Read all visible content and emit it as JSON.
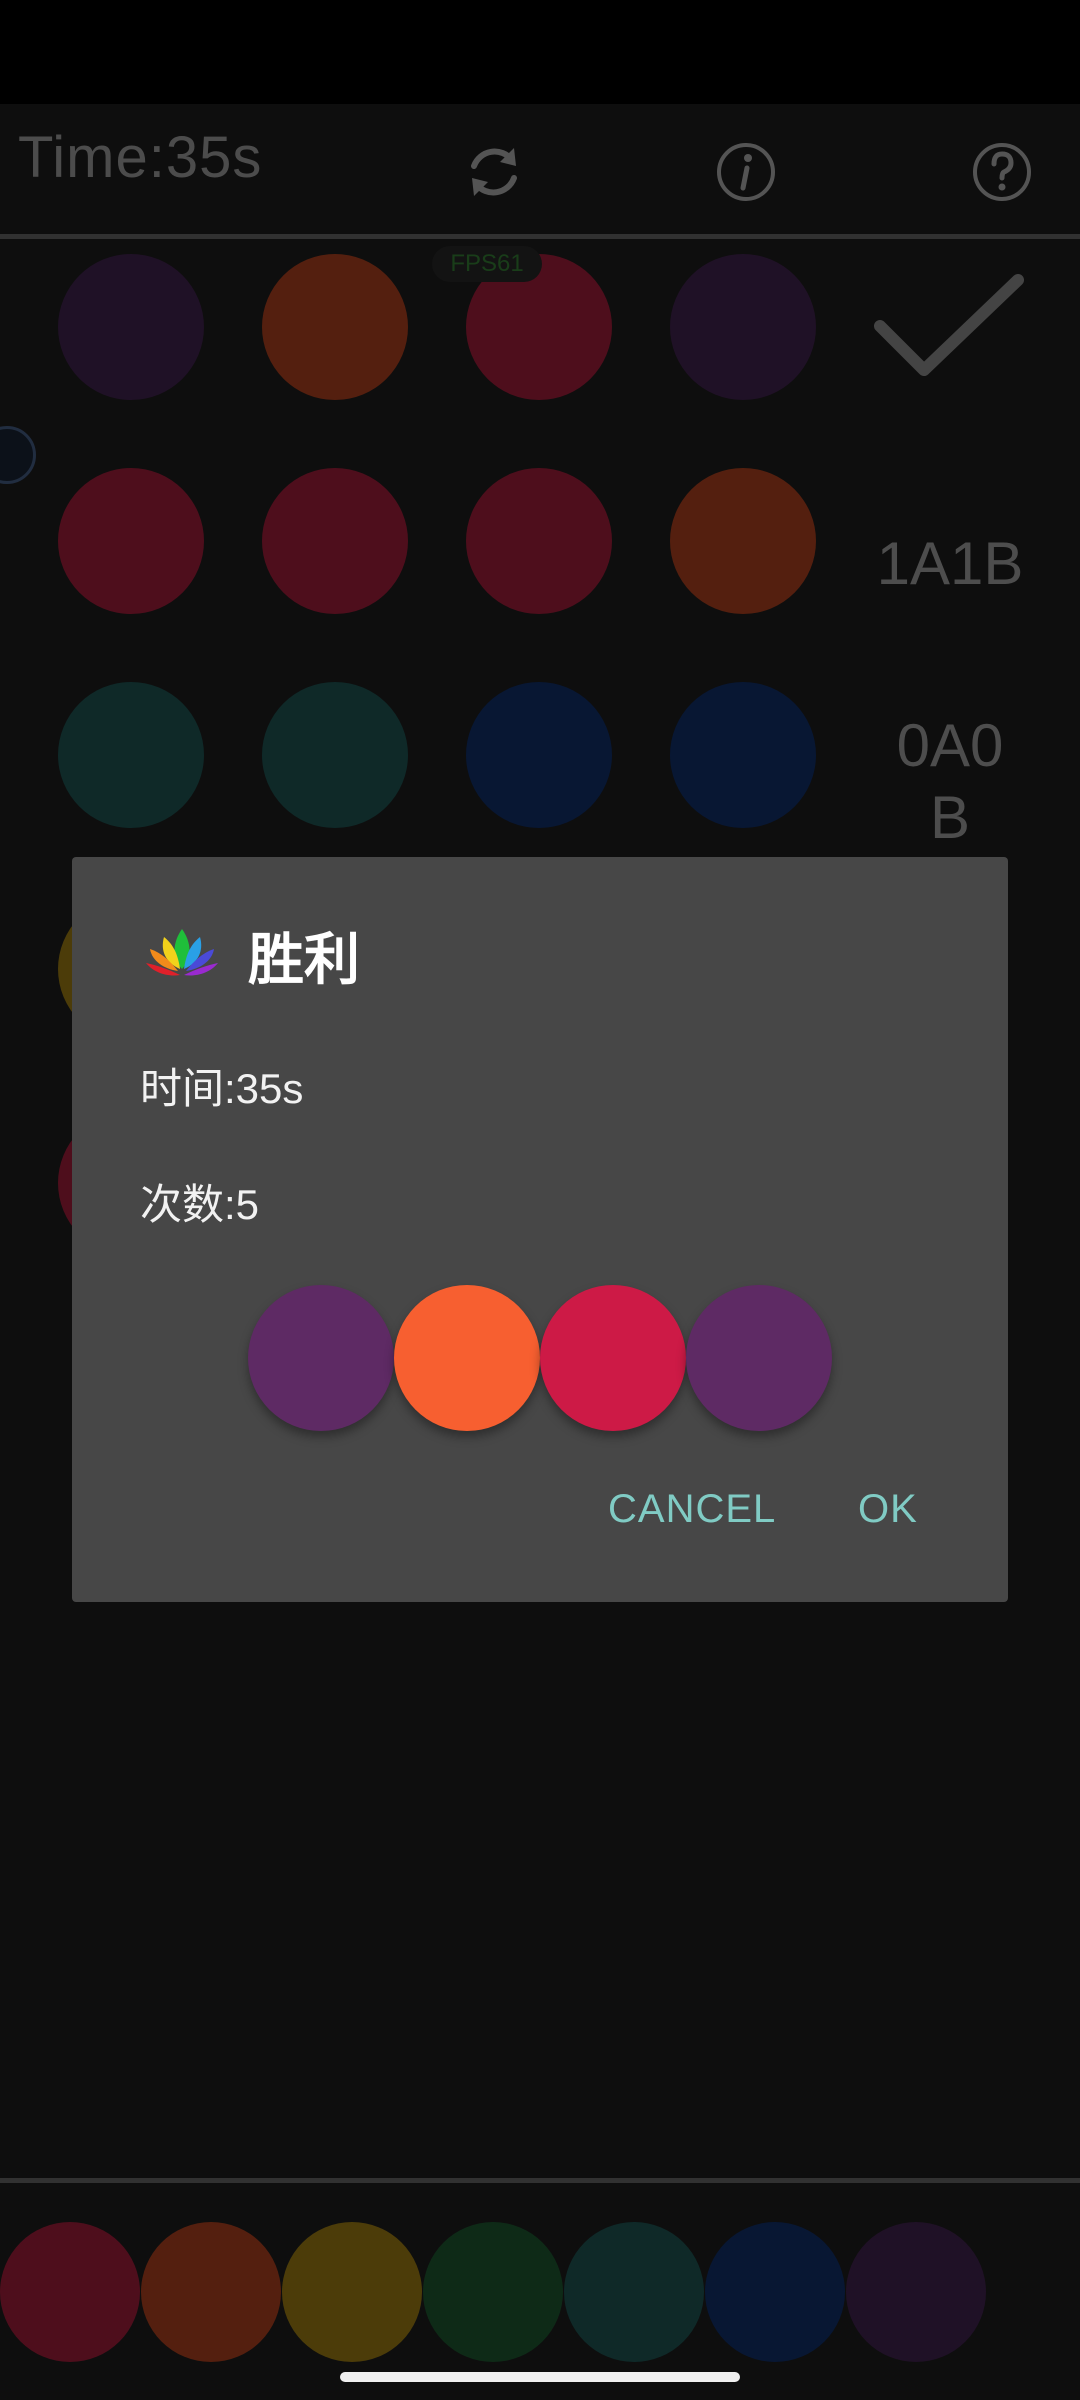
{
  "topbar": {
    "time_label": "Time:35s",
    "refresh_icon": "refresh-icon",
    "info_icon": "info-icon",
    "help_icon": "help-icon"
  },
  "overlay": {
    "fps_label": "FPS61"
  },
  "board": {
    "rows": [
      {
        "colors": [
          "#3a1f45",
          "#9a3a1c",
          "#8e1a34",
          "#3a1f45"
        ],
        "result": "",
        "result_icon": "checkmark-icon"
      },
      {
        "colors": [
          "#8e1a34",
          "#8e1a34",
          "#8e1a34",
          "#9a3a1c"
        ],
        "result": "1A1B"
      },
      {
        "colors": [
          "#1c4b4a",
          "#1c4b4a",
          "#0f2a5e",
          "#0f2a5e"
        ],
        "result": "0A0B"
      }
    ],
    "hidden_left_pegs": [
      "#8a6e12",
      "#8e1a34"
    ]
  },
  "dialog": {
    "icon": "lotus-icon",
    "title": "胜利",
    "time_line": "时间:35s",
    "count_line": "次数:5",
    "answer_colors": [
      "#5e2a64",
      "#f75f30",
      "#cd1a46",
      "#5e2a64"
    ],
    "cancel_label": "CANCEL",
    "ok_label": "OK"
  },
  "palette": {
    "colors": [
      "#8e1a34",
      "#9a3a1c",
      "#8a6e12",
      "#1a4d2b",
      "#1c4b4a",
      "#0f2a5e",
      "#3a1f45"
    ]
  }
}
